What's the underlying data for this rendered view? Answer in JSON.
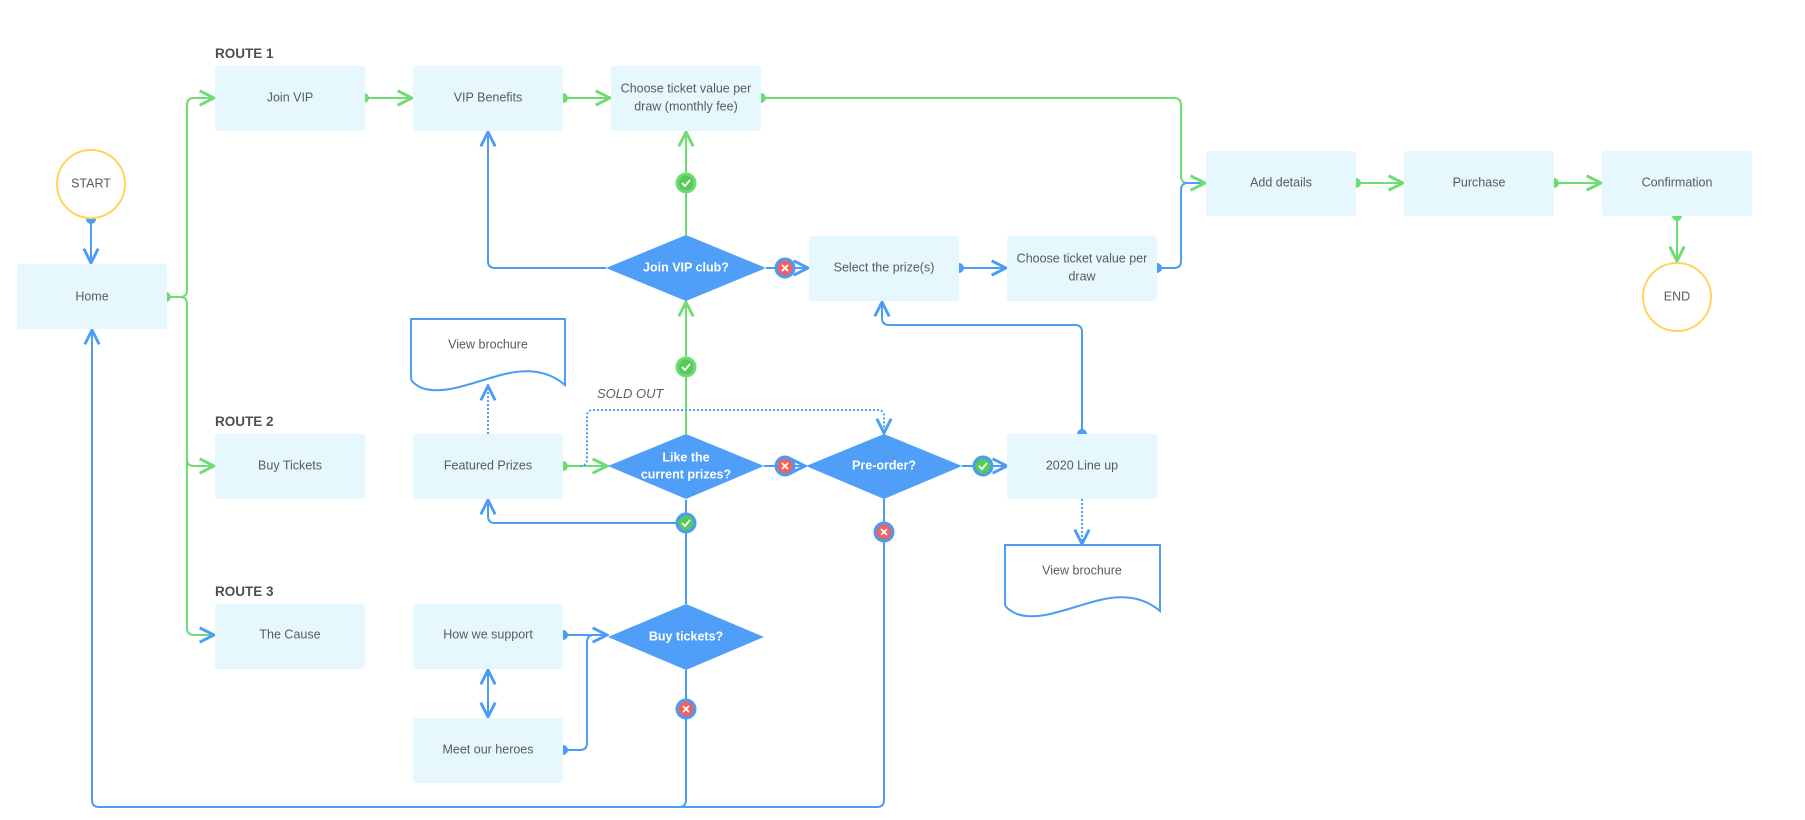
{
  "colors": {
    "box_fill": "#e6f8fd",
    "decision_fill": "#4f9ef7",
    "yes_line": "#6ddc72",
    "no_line": "#4a9cf5",
    "terminal_stroke": "#ffd35c",
    "yes_badge": "#55c95a",
    "no_badge": "#f0625f"
  },
  "routes": {
    "route1": "ROUTE 1",
    "route2": "ROUTE 2",
    "route3": "ROUTE 3"
  },
  "terminals": {
    "start": "START",
    "end": "END"
  },
  "nodes": {
    "home": "Home",
    "join_vip": "Join VIP",
    "vip_benefits": "VIP Benefits",
    "choose_monthly_1": "Choose ticket value per",
    "choose_monthly_2": "draw (monthly fee)",
    "add_details": "Add details",
    "purchase": "Purchase",
    "confirmation": "Confirmation",
    "select_prizes": "Select the prize(s)",
    "choose_draw_1": "Choose ticket value per",
    "choose_draw_2": "draw",
    "buy_tickets": "Buy Tickets",
    "featured_prizes": "Featured Prizes",
    "lineup_2020": "2020 Line up",
    "the_cause": "The Cause",
    "how_we_support": "How we support",
    "meet_heroes": "Meet our heroes",
    "brochure_1": "View brochure",
    "brochure_2": "View brochure"
  },
  "decisions": {
    "join_vip_club": "Join VIP club?",
    "like_prizes_1": "Like the",
    "like_prizes_2": "current prizes?",
    "pre_order": "Pre-order?",
    "buy_tickets_q": "Buy tickets?"
  },
  "annotations": {
    "sold_out": "SOLD OUT"
  }
}
